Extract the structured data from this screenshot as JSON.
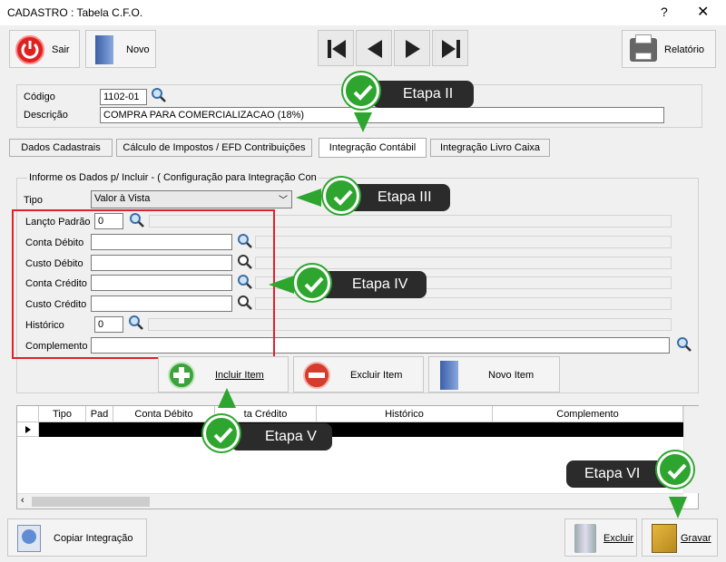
{
  "window": {
    "title": "CADASTRO : Tabela C.F.O.",
    "help": "?",
    "close": "✕"
  },
  "toolbar": {
    "sair": "Sair",
    "novo": "Novo",
    "relatorio": "Relatório"
  },
  "form": {
    "codigo_label": "Código",
    "codigo_value": "1102-01",
    "descricao_label": "Descrição",
    "descricao_value": "COMPRA PARA COMERCIALIZACAO (18%)"
  },
  "tabs": [
    "Dados Cadastrais",
    "Cálculo de Impostos / EFD Contribuições",
    "Integração Contábil",
    "Integração Livro Caixa"
  ],
  "group": {
    "caption": "Informe os Dados p/ Incluir  -  ( Configuração para  Integração  Con",
    "tipo_label": "Tipo",
    "tipo_value": "Valor à Vista",
    "lancto_label": "Lançto Padrão",
    "lancto_value": "0",
    "conta_debito_label": "Conta Débito",
    "custo_debito_label": "Custo Débito",
    "conta_credito_label": "Conta Crédito",
    "custo_credito_label": "Custo Crédito",
    "historico_label": "Histórico",
    "historico_value": "0",
    "complemento_label": "Complemento"
  },
  "actions": {
    "incluir": "Incluir Item",
    "excluir": "Excluir Item",
    "novo_item": "Novo Item"
  },
  "grid": {
    "columns": [
      "Tipo",
      "Pad",
      "Conta Débito",
      "ta Crédito",
      "Histórico",
      "Complemento"
    ]
  },
  "footer": {
    "copiar": "Copiar Integração",
    "excluir": "Excluir",
    "gravar": "Gravar"
  },
  "callouts": {
    "etapa2": "Etapa II",
    "etapa3": "Etapa III",
    "etapa4": "Etapa IV",
    "etapa5": "Etapa V",
    "etapa6": "Etapa VI"
  },
  "colors": {
    "callout_bg": "#2b2b2b",
    "check_green": "#2ea52e",
    "highlight_red": "#e0202a"
  }
}
